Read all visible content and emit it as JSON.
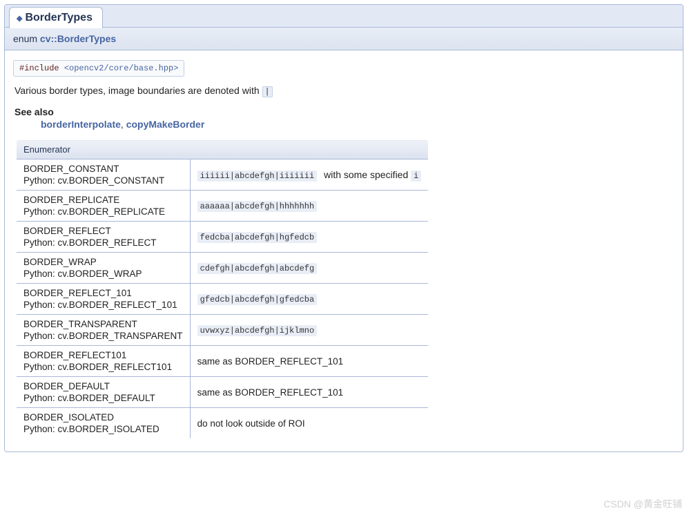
{
  "tab": {
    "title": "BorderTypes"
  },
  "signature": {
    "prefix": "enum ",
    "link": "cv::BorderTypes"
  },
  "include": {
    "keyword": "#include ",
    "path": "<opencv2/core/base.hpp>"
  },
  "description": {
    "text": "Various border types, image boundaries are denoted with ",
    "literal": "|"
  },
  "see_also": {
    "label": "See also",
    "links": [
      "borderInterpolate",
      "copyMakeBorder"
    ],
    "separator": ", "
  },
  "table": {
    "header": "Enumerator",
    "python_prefix": "Python: ",
    "rows": [
      {
        "name": "BORDER_CONSTANT",
        "python": "cv.BORDER_CONSTANT",
        "code": "iiiiii|abcdefgh|iiiiiii",
        "extra": " with some specified ",
        "extra_code": "i"
      },
      {
        "name": "BORDER_REPLICATE",
        "python": "cv.BORDER_REPLICATE",
        "code": "aaaaaa|abcdefgh|hhhhhhh"
      },
      {
        "name": "BORDER_REFLECT",
        "python": "cv.BORDER_REFLECT",
        "code": "fedcba|abcdefgh|hgfedcb"
      },
      {
        "name": "BORDER_WRAP",
        "python": "cv.BORDER_WRAP",
        "code": "cdefgh|abcdefgh|abcdefg"
      },
      {
        "name": "BORDER_REFLECT_101",
        "python": "cv.BORDER_REFLECT_101",
        "code": "gfedcb|abcdefgh|gfedcba"
      },
      {
        "name": "BORDER_TRANSPARENT",
        "python": "cv.BORDER_TRANSPARENT",
        "code": "uvwxyz|abcdefgh|ijklmno"
      },
      {
        "name": "BORDER_REFLECT101",
        "python": "cv.BORDER_REFLECT101",
        "text": "same as BORDER_REFLECT_101"
      },
      {
        "name": "BORDER_DEFAULT",
        "python": "cv.BORDER_DEFAULT",
        "text": "same as BORDER_REFLECT_101"
      },
      {
        "name": "BORDER_ISOLATED",
        "python": "cv.BORDER_ISOLATED",
        "text": "do not look outside of ROI"
      }
    ]
  },
  "watermark": "CSDN @黄金旺铺"
}
